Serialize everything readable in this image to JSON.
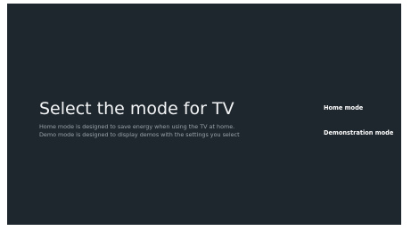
{
  "page": {
    "title": "Select the mode for TV",
    "description": [
      "Home mode is designed to save energy when using the TV at home.",
      "Demo mode is designed to display demos with the settings you select"
    ]
  },
  "options": [
    {
      "label": "Home mode"
    },
    {
      "label": "Demonstration mode"
    }
  ],
  "colors": {
    "background": "#1f272e",
    "title": "#f2f4f5",
    "description": "#9aa3aa",
    "option": "#ffffff"
  }
}
